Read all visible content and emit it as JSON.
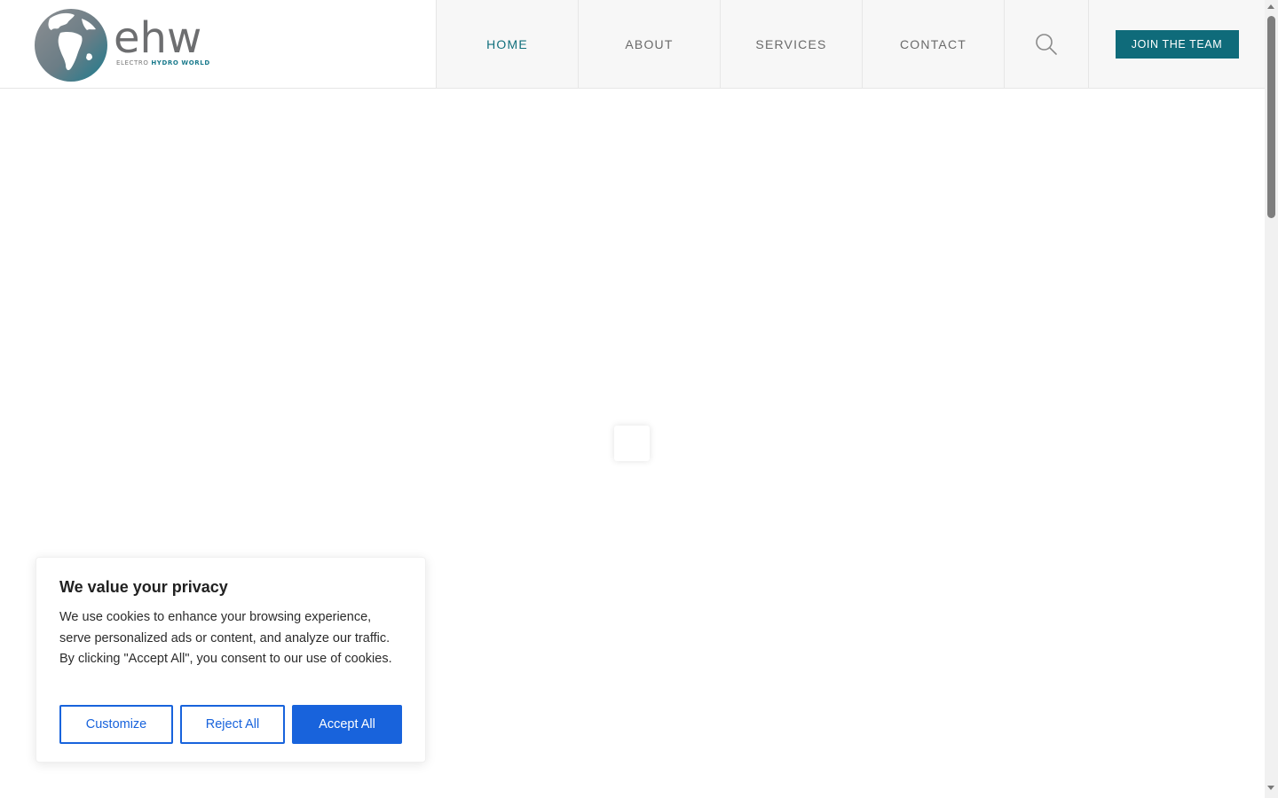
{
  "brand": {
    "name": "ehw",
    "tagline_part1": "ELECTRO",
    "tagline_part2": "HYDRO WORLD",
    "colors": {
      "teal": "#12707d",
      "grey": "#6d6e70"
    }
  },
  "nav": {
    "items": [
      {
        "label": "HOME",
        "active": true
      },
      {
        "label": "ABOUT",
        "active": false
      },
      {
        "label": "SERVICES",
        "active": false
      },
      {
        "label": "CONTACT",
        "active": false
      }
    ],
    "search_icon": "search-icon",
    "cta_label": "JOIN THE TEAM"
  },
  "cookie": {
    "title": "We value your privacy",
    "text": "We use cookies to enhance your browsing experience, serve personalized ads or content, and analyze our traffic. By clicking \"Accept All\", you consent to our use of cookies.",
    "customize_label": "Customize",
    "reject_label": "Reject All",
    "accept_label": "Accept All",
    "accent_color": "#1863dc"
  }
}
